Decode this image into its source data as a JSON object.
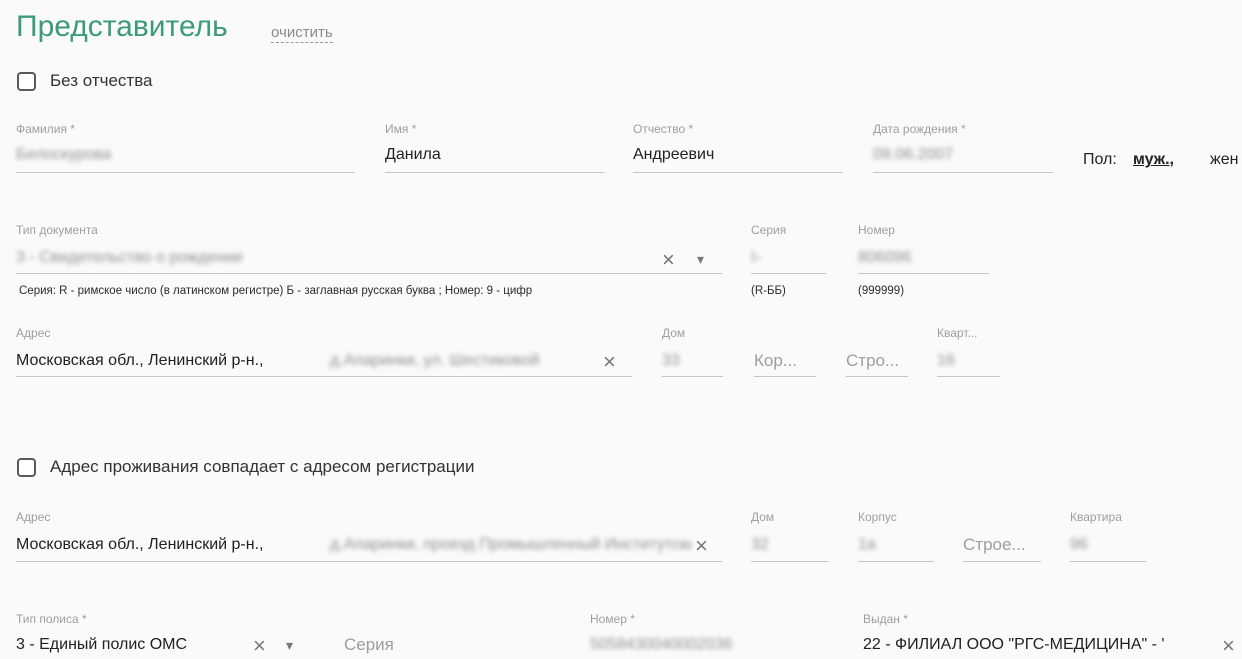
{
  "section": {
    "title": "Представитель",
    "clear_link": "очистить"
  },
  "no_patronymic": {
    "label": "Без отчества",
    "checked": false
  },
  "person": {
    "surname": {
      "label": "Фамилия *",
      "value": "Белоскурова"
    },
    "name": {
      "label": "Имя *",
      "value": "Данила"
    },
    "patronymic": {
      "label": "Отчество *",
      "value": "Андреевич"
    },
    "birth_date": {
      "label": "Дата рождения *",
      "value": "09.06.2007"
    },
    "gender": {
      "label": "Пол:",
      "male": "муж.,",
      "female": "жен"
    }
  },
  "document": {
    "type": {
      "label": "Тип документа",
      "value": "3 - Свидетельство о рождении"
    },
    "series": {
      "label": "Серия",
      "value": "I-",
      "hint": "(R-ББ)"
    },
    "number": {
      "label": "Номер",
      "value": "806096",
      "hint": "(999999)"
    },
    "hint": "Серия: R - римское число (в латинском регистре) Б - заглавная русская буква ; Номер: 9 - цифр"
  },
  "reg_address": {
    "address": {
      "label": "Адрес",
      "prefix": "Московская обл., Ленинский р-н.,",
      "blurred": "д.Апаринки, ул. Шестиковой"
    },
    "house": {
      "label": "Дом",
      "value": "33"
    },
    "korpus": {
      "placeholder": "Кор..."
    },
    "stroenie": {
      "placeholder": "Стро..."
    },
    "apartment": {
      "label": "Кварт...",
      "value": "16"
    }
  },
  "same_address": {
    "label": "Адрес проживания совпадает с адресом регистрации",
    "checked": false
  },
  "live_address": {
    "address": {
      "label": "Адрес",
      "prefix": "Московская обл., Ленинский р-н.,",
      "blurred": "д.Апаринки, проезд Промышленный Институтский"
    },
    "house": {
      "label": "Дом",
      "value": "32"
    },
    "korpus": {
      "label": "Корпус",
      "value": "1а"
    },
    "stroenie": {
      "placeholder": "Строе..."
    },
    "apartment": {
      "label": "Квартира",
      "value": "96"
    }
  },
  "policy": {
    "type": {
      "label": "Тип полиса *",
      "value": "3 - Единый полис ОМС"
    },
    "series": {
      "placeholder": "Серия"
    },
    "number": {
      "label": "Номер *",
      "value": "5058430040002036"
    },
    "issuer": {
      "label": "Выдан *",
      "value": "22 - ФИЛИАЛ ООО \"РГС-МЕДИЦИНА\" - '"
    }
  },
  "icons": {
    "clear": "×",
    "dropdown": "▾"
  }
}
